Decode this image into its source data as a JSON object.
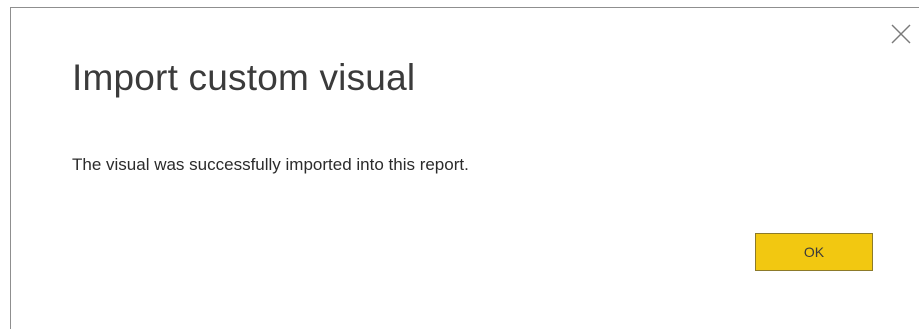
{
  "dialog": {
    "title": "Import custom visual",
    "message": "The visual was successfully imported into this report.",
    "ok_label": "OK",
    "close_icon": "close-icon",
    "accent_color": "#f2c811"
  }
}
